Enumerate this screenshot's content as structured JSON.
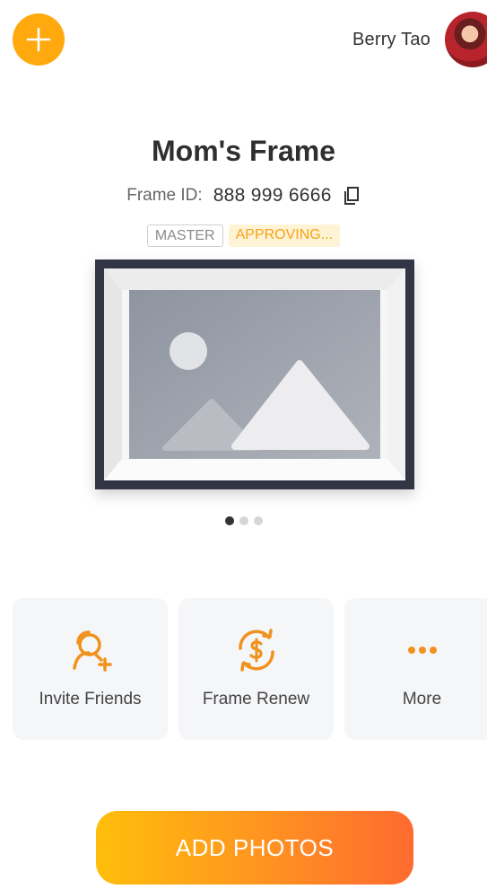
{
  "header": {
    "add_icon": "plus-icon",
    "user_name": "Berry Tao",
    "avatar_icon": "user-avatar"
  },
  "frame": {
    "title": "Mom's Frame",
    "id_label": "Frame ID:",
    "id_value": "888 999 6666",
    "copy_icon": "copy-icon",
    "badges": [
      "MASTER",
      "APPROVING..."
    ],
    "image_placeholder_icon": "image-placeholder-icon"
  },
  "carousel": {
    "total": 3,
    "active": 1
  },
  "actions": [
    {
      "label": "Invite Friends",
      "icon": "add-user-icon"
    },
    {
      "label": "Frame Renew",
      "icon": "renew-dollar-icon"
    },
    {
      "label": "More",
      "icon": "more-dots-icon"
    }
  ],
  "cta": {
    "label": "ADD PHOTOS"
  },
  "colors": {
    "accent": "#FFA90F",
    "icon_orange": "#F0921E",
    "frame_border": "#323644",
    "cta_start": "#FFBE0A",
    "cta_end": "#FF6A30"
  }
}
